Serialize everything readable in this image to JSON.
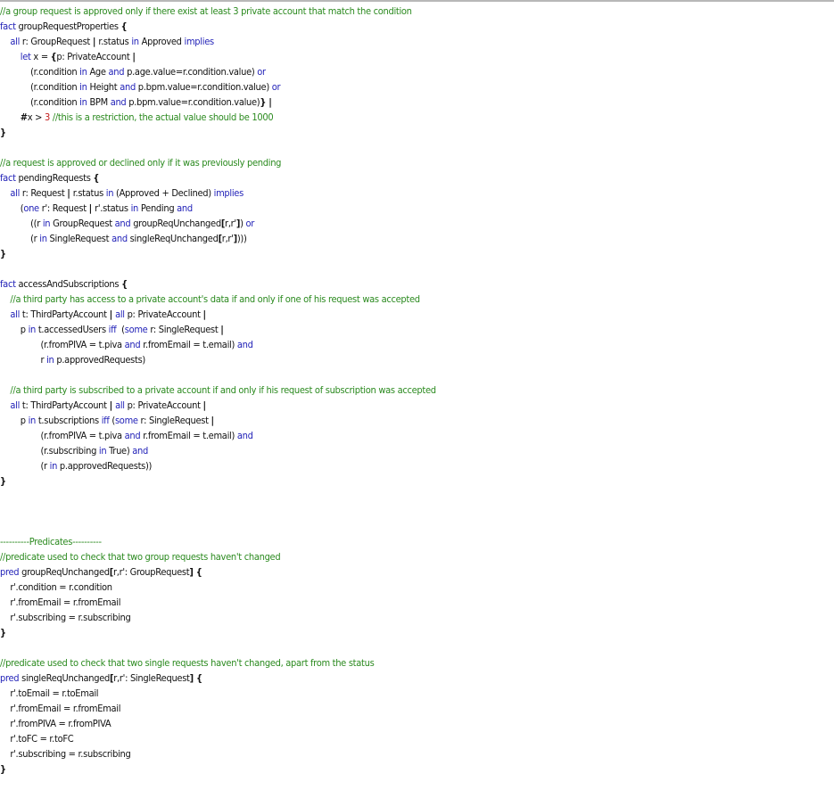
{
  "colors": {
    "keyword": "#2323b8",
    "comment": "#2b8a1f",
    "number": "#c21a1a",
    "plain": "#111111",
    "background": "#ffffff"
  },
  "lines": [
    [
      {
        "t": "com",
        "s": "//a group request is approved only if there exist at least 3 private account that match the condition"
      }
    ],
    [
      {
        "t": "kw",
        "s": "fact "
      },
      {
        "t": "plain",
        "s": "groupRequestProperties "
      },
      {
        "t": "punc",
        "s": "{"
      }
    ],
    [
      {
        "t": "plain",
        "s": "    "
      },
      {
        "t": "kw",
        "s": "all "
      },
      {
        "t": "plain",
        "s": "r: GroupRequest "
      },
      {
        "t": "punc",
        "s": "| "
      },
      {
        "t": "plain",
        "s": "r.status "
      },
      {
        "t": "kw",
        "s": "in "
      },
      {
        "t": "plain",
        "s": "Approved "
      },
      {
        "t": "kw",
        "s": "implies"
      }
    ],
    [
      {
        "t": "plain",
        "s": "        "
      },
      {
        "t": "kw",
        "s": "let "
      },
      {
        "t": "plain",
        "s": "x = "
      },
      {
        "t": "punc",
        "s": "{"
      },
      {
        "t": "plain",
        "s": "p: PrivateAccount "
      },
      {
        "t": "punc",
        "s": "|"
      }
    ],
    [
      {
        "t": "plain",
        "s": "            (r.condition "
      },
      {
        "t": "kw",
        "s": "in "
      },
      {
        "t": "plain",
        "s": "Age "
      },
      {
        "t": "kw",
        "s": "and "
      },
      {
        "t": "plain",
        "s": "p.age.value=r.condition.value) "
      },
      {
        "t": "kw",
        "s": "or"
      }
    ],
    [
      {
        "t": "plain",
        "s": "            (r.condition "
      },
      {
        "t": "kw",
        "s": "in "
      },
      {
        "t": "plain",
        "s": "Height "
      },
      {
        "t": "kw",
        "s": "and "
      },
      {
        "t": "plain",
        "s": "p.bpm.value=r.condition.value) "
      },
      {
        "t": "kw",
        "s": "or"
      }
    ],
    [
      {
        "t": "plain",
        "s": "            (r.condition "
      },
      {
        "t": "kw",
        "s": "in "
      },
      {
        "t": "plain",
        "s": "BPM "
      },
      {
        "t": "kw",
        "s": "and "
      },
      {
        "t": "plain",
        "s": "p.bpm.value=r.condition.value)"
      },
      {
        "t": "punc",
        "s": "} |"
      }
    ],
    [
      {
        "t": "plain",
        "s": "        "
      },
      {
        "t": "punc",
        "s": "#"
      },
      {
        "t": "plain",
        "s": "x > "
      },
      {
        "t": "num",
        "s": "3 "
      },
      {
        "t": "com",
        "s": "//this is a restriction, the actual value should be 1000"
      }
    ],
    [
      {
        "t": "punc",
        "s": "}"
      }
    ],
    [],
    [
      {
        "t": "com",
        "s": "//a request is approved or declined only if it was previously pending"
      }
    ],
    [
      {
        "t": "kw",
        "s": "fact "
      },
      {
        "t": "plain",
        "s": "pendingRequests "
      },
      {
        "t": "punc",
        "s": "{"
      }
    ],
    [
      {
        "t": "plain",
        "s": "    "
      },
      {
        "t": "kw",
        "s": "all "
      },
      {
        "t": "plain",
        "s": "r: Request "
      },
      {
        "t": "punc",
        "s": "| "
      },
      {
        "t": "plain",
        "s": "r.status "
      },
      {
        "t": "kw",
        "s": "in "
      },
      {
        "t": "plain",
        "s": "(Approved + Declined) "
      },
      {
        "t": "kw",
        "s": "implies"
      }
    ],
    [
      {
        "t": "plain",
        "s": "        ("
      },
      {
        "t": "kw",
        "s": "one "
      },
      {
        "t": "plain",
        "s": "r': Request "
      },
      {
        "t": "punc",
        "s": "| "
      },
      {
        "t": "plain",
        "s": "r'.status "
      },
      {
        "t": "kw",
        "s": "in "
      },
      {
        "t": "plain",
        "s": "Pending "
      },
      {
        "t": "kw",
        "s": "and"
      }
    ],
    [
      {
        "t": "plain",
        "s": "            (("
      },
      {
        "t": "plain",
        "s": "r "
      },
      {
        "t": "kw",
        "s": "in "
      },
      {
        "t": "plain",
        "s": "GroupRequest "
      },
      {
        "t": "kw",
        "s": "and "
      },
      {
        "t": "plain",
        "s": "groupReqUnchanged"
      },
      {
        "t": "punc",
        "s": "["
      },
      {
        "t": "plain",
        "s": "r,r'"
      },
      {
        "t": "punc",
        "s": "]"
      },
      {
        "t": "plain",
        "s": ") "
      },
      {
        "t": "kw",
        "s": "or"
      }
    ],
    [
      {
        "t": "plain",
        "s": "            (r "
      },
      {
        "t": "kw",
        "s": "in "
      },
      {
        "t": "plain",
        "s": "SingleRequest "
      },
      {
        "t": "kw",
        "s": "and "
      },
      {
        "t": "plain",
        "s": "singleReqUnchanged"
      },
      {
        "t": "punc",
        "s": "["
      },
      {
        "t": "plain",
        "s": "r,r'"
      },
      {
        "t": "punc",
        "s": "]"
      },
      {
        "t": "plain",
        "s": ")))"
      }
    ],
    [
      {
        "t": "punc",
        "s": "}"
      }
    ],
    [],
    [
      {
        "t": "kw",
        "s": "fact "
      },
      {
        "t": "plain",
        "s": "accessAndSubscriptions "
      },
      {
        "t": "punc",
        "s": "{"
      }
    ],
    [
      {
        "t": "plain",
        "s": "    "
      },
      {
        "t": "com",
        "s": "//a third party has access to a private account's data if and only if one of his request was accepted"
      }
    ],
    [
      {
        "t": "plain",
        "s": "    "
      },
      {
        "t": "kw",
        "s": "all "
      },
      {
        "t": "plain",
        "s": "t: ThirdPartyAccount "
      },
      {
        "t": "punc",
        "s": "| "
      },
      {
        "t": "kw",
        "s": "all "
      },
      {
        "t": "plain",
        "s": "p: PrivateAccount "
      },
      {
        "t": "punc",
        "s": "|"
      }
    ],
    [
      {
        "t": "plain",
        "s": "        p "
      },
      {
        "t": "kw",
        "s": "in "
      },
      {
        "t": "plain",
        "s": "t.accessedUsers "
      },
      {
        "t": "kw",
        "s": "iff  "
      },
      {
        "t": "plain",
        "s": "("
      },
      {
        "t": "kw",
        "s": "some "
      },
      {
        "t": "plain",
        "s": "r: SingleRequest "
      },
      {
        "t": "punc",
        "s": "|"
      }
    ],
    [
      {
        "t": "plain",
        "s": "                (r.fromPIVA = t.piva "
      },
      {
        "t": "kw",
        "s": "and "
      },
      {
        "t": "plain",
        "s": "r.fromEmail = t.email) "
      },
      {
        "t": "kw",
        "s": "and"
      }
    ],
    [
      {
        "t": "plain",
        "s": "                r "
      },
      {
        "t": "kw",
        "s": "in "
      },
      {
        "t": "plain",
        "s": "p.approvedRequests)"
      }
    ],
    [],
    [
      {
        "t": "plain",
        "s": "    "
      },
      {
        "t": "com",
        "s": "//a third party is subscribed to a private account if and only if his request of subscription was accepted"
      }
    ],
    [
      {
        "t": "plain",
        "s": "    "
      },
      {
        "t": "kw",
        "s": "all "
      },
      {
        "t": "plain",
        "s": "t: ThirdPartyAccount "
      },
      {
        "t": "punc",
        "s": "| "
      },
      {
        "t": "kw",
        "s": "all "
      },
      {
        "t": "plain",
        "s": "p: PrivateAccount "
      },
      {
        "t": "punc",
        "s": "|"
      }
    ],
    [
      {
        "t": "plain",
        "s": "        p "
      },
      {
        "t": "kw",
        "s": "in "
      },
      {
        "t": "plain",
        "s": "t.subscriptions "
      },
      {
        "t": "kw",
        "s": "iff "
      },
      {
        "t": "plain",
        "s": "("
      },
      {
        "t": "kw",
        "s": "some "
      },
      {
        "t": "plain",
        "s": "r: SingleRequest "
      },
      {
        "t": "punc",
        "s": "|"
      }
    ],
    [
      {
        "t": "plain",
        "s": "                (r.fromPIVA = t.piva "
      },
      {
        "t": "kw",
        "s": "and "
      },
      {
        "t": "plain",
        "s": "r.fromEmail = t.email) "
      },
      {
        "t": "kw",
        "s": "and"
      }
    ],
    [
      {
        "t": "plain",
        "s": "                (r.subscribing "
      },
      {
        "t": "kw",
        "s": "in "
      },
      {
        "t": "plain",
        "s": "True) "
      },
      {
        "t": "kw",
        "s": "and"
      }
    ],
    [
      {
        "t": "plain",
        "s": "                (r "
      },
      {
        "t": "kw",
        "s": "in "
      },
      {
        "t": "plain",
        "s": "p.approvedRequests))"
      }
    ],
    [
      {
        "t": "punc",
        "s": "}"
      }
    ],
    [],
    [],
    [],
    [
      {
        "t": "com",
        "s": "----------Predicates----------"
      }
    ],
    [
      {
        "t": "com",
        "s": "//predicate used to check that two group requests haven't changed"
      }
    ],
    [
      {
        "t": "kw",
        "s": "pred "
      },
      {
        "t": "plain",
        "s": "groupReqUnchanged"
      },
      {
        "t": "punc",
        "s": "["
      },
      {
        "t": "plain",
        "s": "r,r': GroupRequest"
      },
      {
        "t": "punc",
        "s": "] {"
      }
    ],
    [
      {
        "t": "plain",
        "s": "    r'.condition = r.condition"
      }
    ],
    [
      {
        "t": "plain",
        "s": "    r'.fromEmail = r.fromEmail"
      }
    ],
    [
      {
        "t": "plain",
        "s": "    r'.subscribing = r.subscribing"
      }
    ],
    [
      {
        "t": "punc",
        "s": "}"
      }
    ],
    [],
    [
      {
        "t": "com",
        "s": "//predicate used to check that two single requests haven't changed, apart from the status"
      }
    ],
    [
      {
        "t": "kw",
        "s": "pred "
      },
      {
        "t": "plain",
        "s": "singleReqUnchanged"
      },
      {
        "t": "punc",
        "s": "["
      },
      {
        "t": "plain",
        "s": "r,r': SingleRequest"
      },
      {
        "t": "punc",
        "s": "] {"
      }
    ],
    [
      {
        "t": "plain",
        "s": "    r'.toEmail = r.toEmail"
      }
    ],
    [
      {
        "t": "plain",
        "s": "    r'.fromEmail = r.fromEmail"
      }
    ],
    [
      {
        "t": "plain",
        "s": "    r'.fromPIVA = r.fromPIVA"
      }
    ],
    [
      {
        "t": "plain",
        "s": "    r'.toFC = r.toFC"
      }
    ],
    [
      {
        "t": "plain",
        "s": "    r'.subscribing = r.subscribing"
      }
    ],
    [
      {
        "t": "punc",
        "s": "}"
      }
    ]
  ]
}
